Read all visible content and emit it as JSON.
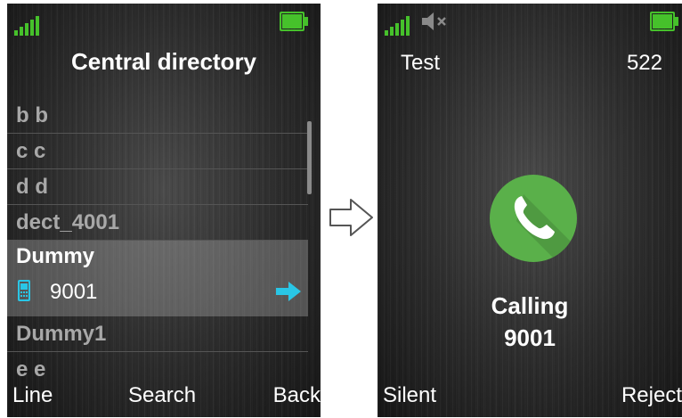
{
  "left_screen": {
    "title": "Central directory",
    "list": [
      {
        "label": "b b"
      },
      {
        "label": "c c"
      },
      {
        "label": "d d"
      },
      {
        "label": "dect_4001"
      }
    ],
    "selected": {
      "name": "Dummy",
      "number": "9001"
    },
    "list_after": [
      {
        "label": "Dummy1"
      },
      {
        "label": "e e"
      }
    ],
    "softkeys": {
      "left": "Line",
      "center": "Search",
      "right": "Back"
    }
  },
  "right_screen": {
    "caller_name": "Test",
    "extension": "522",
    "status": "Calling",
    "number": "9001",
    "softkeys": {
      "left": "Silent",
      "right": "Reject"
    }
  },
  "icons": {
    "signal": "signal-strength-icon",
    "battery": "battery-icon",
    "muted": "speaker-muted-icon",
    "phone": "mobile-phone-icon",
    "arrow": "arrow-right-icon",
    "call": "handset-icon",
    "transition": "chevron-right-icon"
  },
  "colors": {
    "status_green": "#46c12b",
    "accent_cyan": "#29c6e6",
    "call_green": "#5ab04a"
  }
}
